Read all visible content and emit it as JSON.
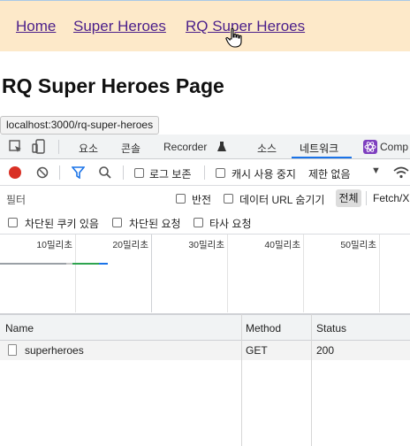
{
  "nav": {
    "links": [
      "Home",
      "Super Heroes",
      "RQ Super Heroes"
    ]
  },
  "page": {
    "title": "RQ Super Heroes Page"
  },
  "tooltip": {
    "url": "localhost:3000/rq-super-heroes"
  },
  "devtools": {
    "tabs": [
      "요소",
      "콘솔",
      "Recorder",
      "소스",
      "네트워크",
      "Comp"
    ],
    "active_tab": "네트워크",
    "toolbar": {
      "preserve_log": "로그 보존",
      "disable_cache": "캐시 사용 중지",
      "throttling": "제한 없음"
    },
    "filter": {
      "placeholder": "필터",
      "invert": "반전",
      "hide_data_urls": "데이터 URL 숨기기",
      "all": "전체",
      "fetch_xhr": "Fetch/X"
    },
    "options": {
      "blocked_cookies": "차단된 쿠키 있음",
      "blocked_requests": "차단된 요청",
      "third_party": "타사 요청"
    },
    "timeline_ticks": [
      "10밀리초",
      "20밀리초",
      "30밀리초",
      "40밀리초",
      "50밀리초"
    ],
    "columns": [
      "Name",
      "Method",
      "Status"
    ],
    "rows": [
      {
        "name": "superheroes",
        "method": "GET",
        "status": "200"
      }
    ]
  },
  "colors": {
    "nav_bg": "#fde9c9",
    "link": "#4b1f8a",
    "accent": "#1a73e8",
    "record": "#d93025"
  }
}
